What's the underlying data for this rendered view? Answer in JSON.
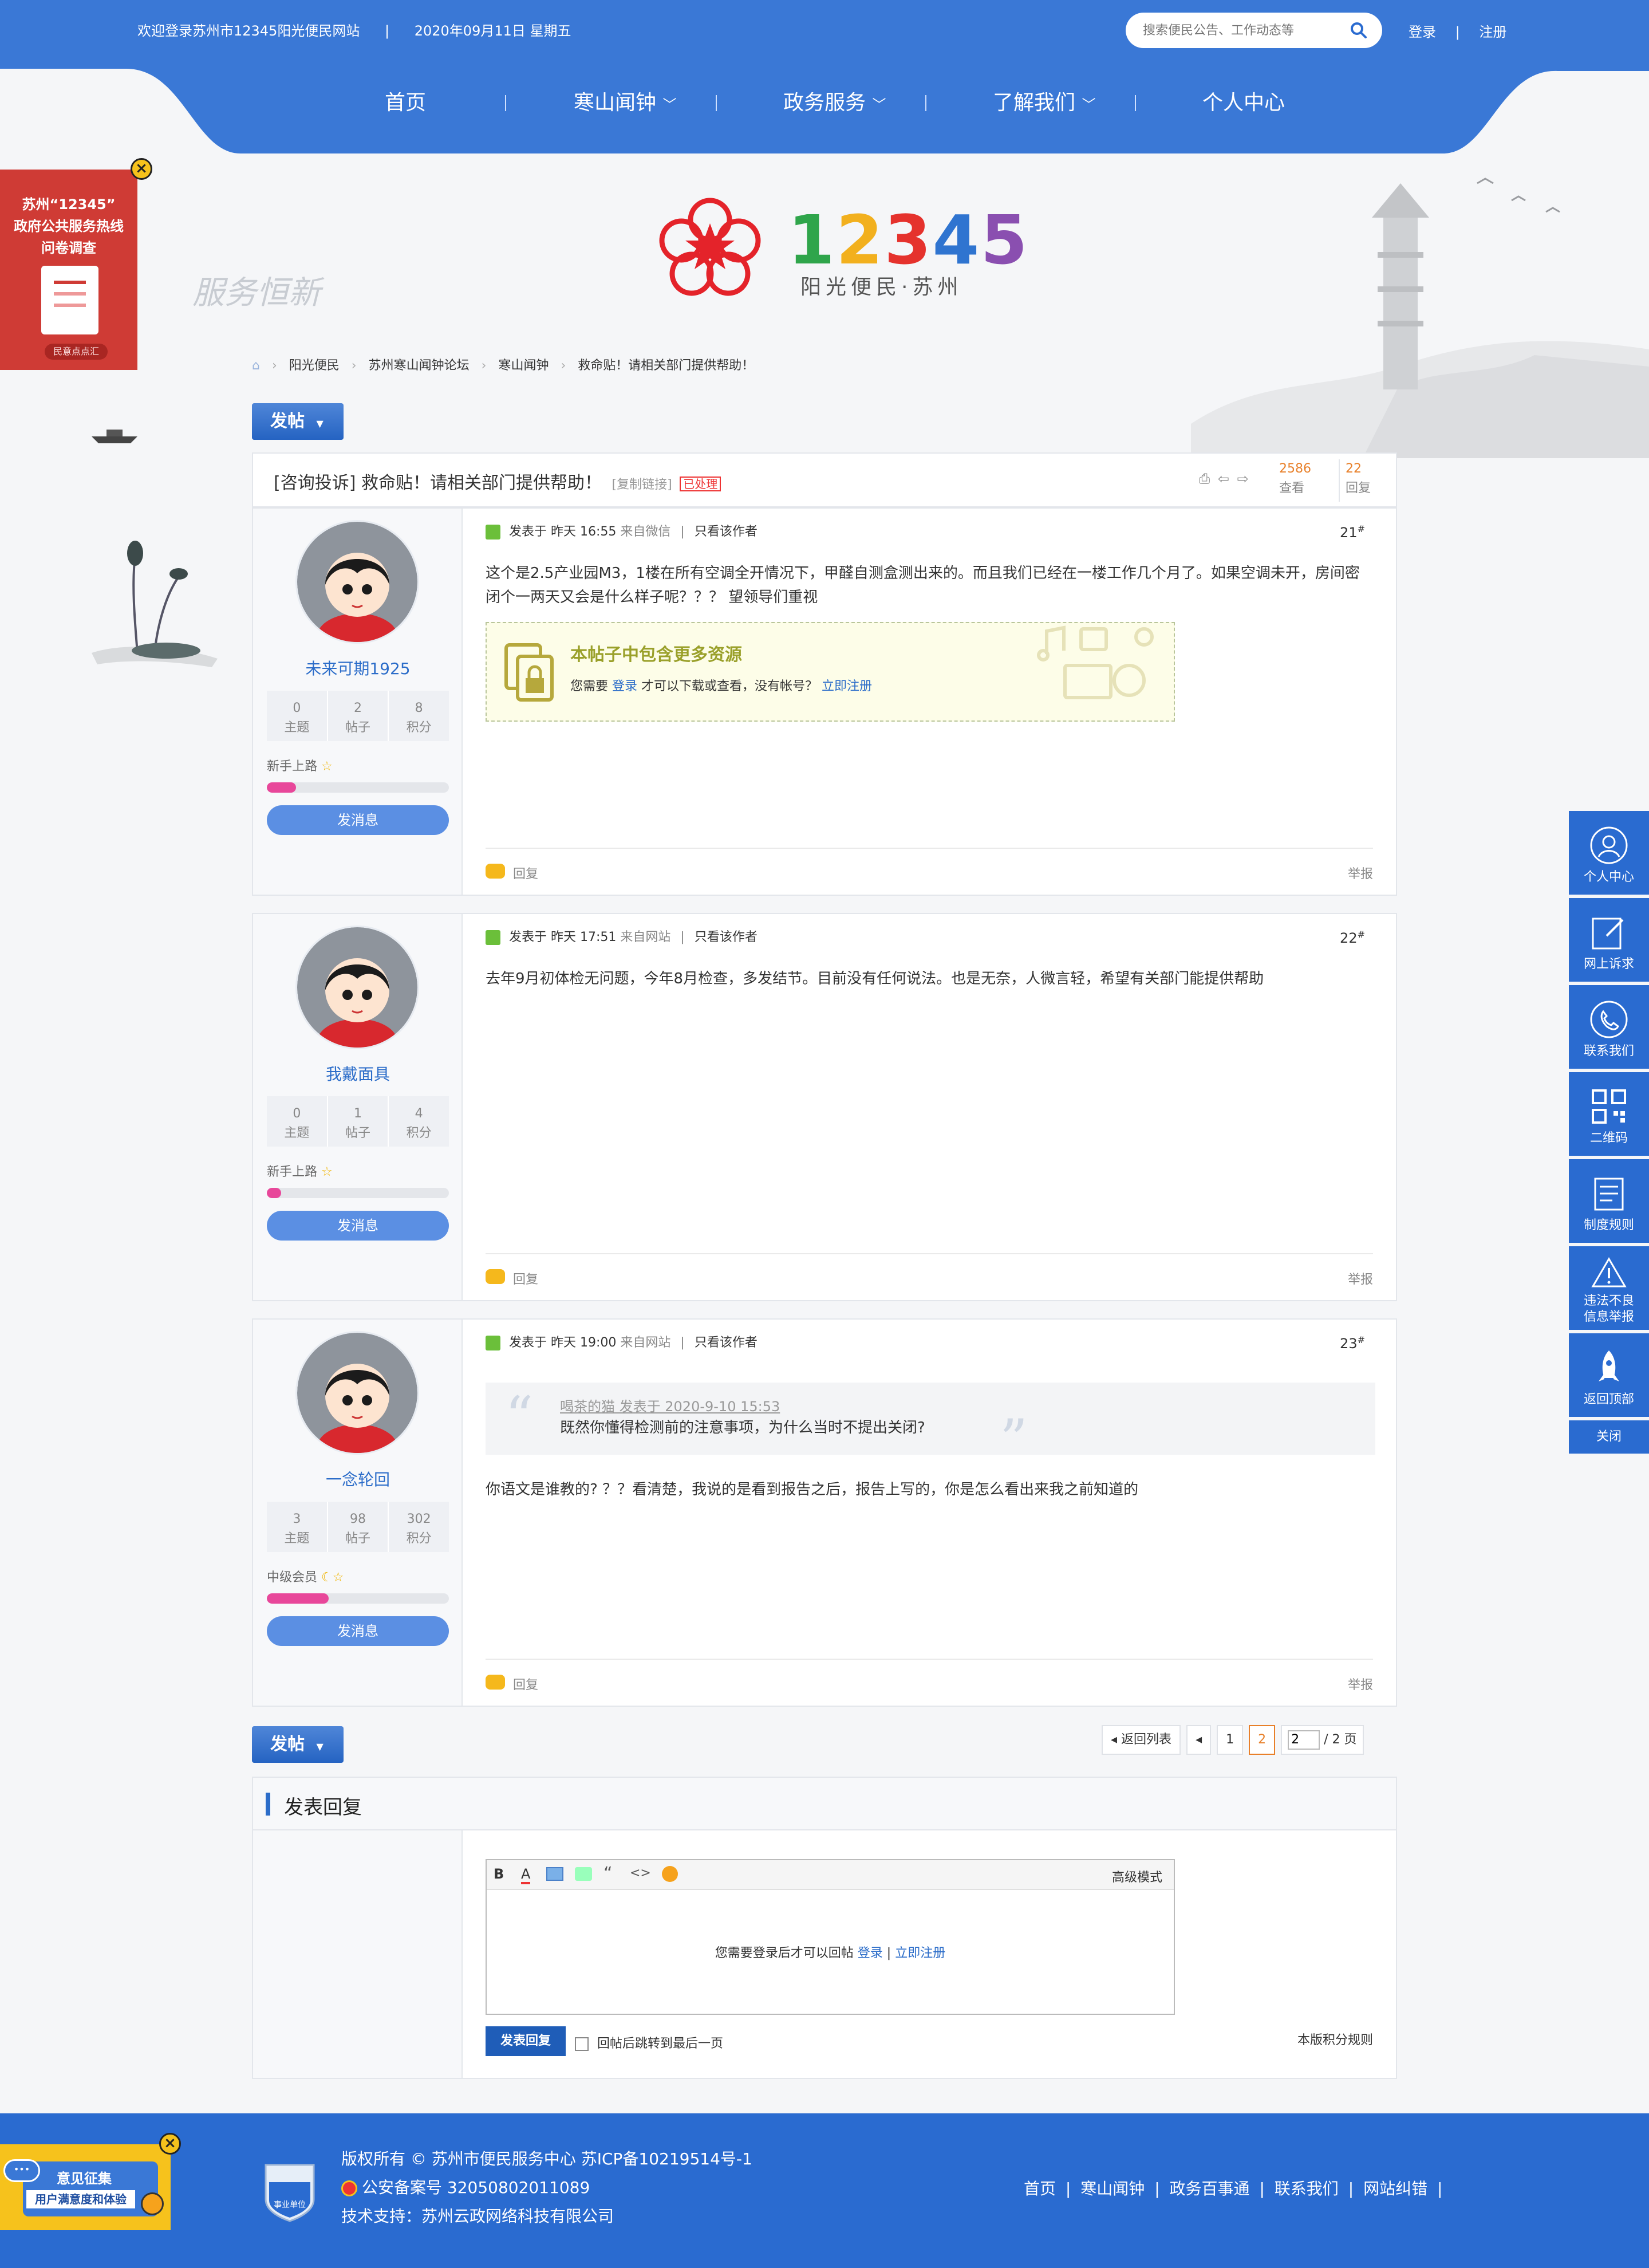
{
  "header": {
    "welcome": "欢迎登录苏州市12345阳光便民网站",
    "divider": "|",
    "date": "2020年09月11日 星期五",
    "search_placeholder": "搜索便民公告、工作动态等",
    "login": "登录",
    "register": "注册",
    "link_divider": "|"
  },
  "nav": {
    "items": [
      "首页",
      "寒山闻钟",
      "政务服务",
      "了解我们",
      "个人中心"
    ]
  },
  "logo": {
    "number": "12345",
    "subtitle": "阳光便民·苏州",
    "calligraphy": "服务恒新"
  },
  "survey_ad": {
    "line1": "苏州“12345”",
    "line2": "政府公共服务热线",
    "line3": "问卷调查",
    "button": "民意点点汇"
  },
  "breadcrumb": [
    "阳光便民",
    "苏州寒山闻钟论坛",
    "寒山闻钟",
    "救命贴！请相关部门提供帮助！"
  ],
  "post_button": "发帖",
  "thread": {
    "title": "[咨询投诉] 救命贴！请相关部门提供帮助！",
    "copy_link": "[复制链接]",
    "status": "已处理",
    "views": "2586",
    "views_label": "查看",
    "replies": "22",
    "replies_label": "回复"
  },
  "posts": [
    {
      "username": "未来可期1925",
      "stats": [
        {
          "v": "0",
          "l": "主题"
        },
        {
          "v": "2",
          "l": "帖子"
        },
        {
          "v": "8",
          "l": "积分"
        }
      ],
      "level": "新手上路",
      "progress": 0.16,
      "msg_button": "发消息",
      "meta_prefix": "发表于 昨天 16:55",
      "meta_source": "来自微信",
      "meta_only": "只看该作者",
      "floor": "21",
      "content": "这个是2.5产业园M3，1楼在所有空调全开情况下，甲醛自测盒测出来的。而且我们已经在一楼工作几个月了。如果空调未开，房间密闭个一两天又会是什么样子呢？？？ 望领导们重视",
      "reply": "回复",
      "report": "举报"
    },
    {
      "username": "我戴面具",
      "stats": [
        {
          "v": "0",
          "l": "主题"
        },
        {
          "v": "1",
          "l": "帖子"
        },
        {
          "v": "4",
          "l": "积分"
        }
      ],
      "level": "新手上路",
      "progress": 0.08,
      "msg_button": "发消息",
      "meta_prefix": "发表于 昨天 17:51",
      "meta_source": "来自网站",
      "meta_only": "只看该作者",
      "floor": "22",
      "content": "去年9月初体检无问题，今年8月检查，多发结节。目前没有任何说法。也是无奈，人微言轻，希望有关部门能提供帮助",
      "reply": "回复",
      "report": "举报"
    },
    {
      "username": "一念轮回",
      "stats": [
        {
          "v": "3",
          "l": "主题"
        },
        {
          "v": "98",
          "l": "帖子"
        },
        {
          "v": "302",
          "l": "积分"
        }
      ],
      "level": "中级会员",
      "progress": 0.34,
      "msg_button": "发消息",
      "meta_prefix": "发表于 昨天 19:00",
      "meta_source": "来自网站",
      "meta_only": "只看该作者",
      "floor": "23",
      "quote_author": "喝茶的猫 发表于 2020-9-10 15:53",
      "quote_text": "既然你懂得检测前的注意事项，为什么当时不提出关闭?",
      "content": "你语文是谁教的? ？？看清楚，我说的是看到报告之后，报告上写的，你是怎么看出来我之前知道的",
      "reply": "回复",
      "report": "举报"
    }
  ],
  "attachment": {
    "title": "本帖子中包含更多资源",
    "text1": "您需要",
    "login": "登录",
    "text2": "才可以下载或查看，没有帐号？",
    "register": "立即注册"
  },
  "pagination": {
    "back": "返回列表",
    "pages": [
      "1",
      "2"
    ],
    "current": "2",
    "input_value": "2",
    "total": "/ 2 页"
  },
  "reply_box": {
    "title": "发表回复",
    "advanced": "高级模式",
    "login_prompt": "您需要登录后才可以回帖",
    "login": "登录",
    "sep": "|",
    "register": "立即注册",
    "submit": "发表回复",
    "jump_label": "回帖后跳转到最后一页",
    "rules": "本版积分规则"
  },
  "right_panel": [
    "个人中心",
    "网上诉求",
    "联系我们",
    "二维码",
    "制度规则",
    "违法不良\n信息举报",
    "返回顶部"
  ],
  "close_label": "关闭",
  "feedback_ad": {
    "title": "意见征集",
    "subtitle": "用户满意度和体验"
  },
  "footer": {
    "copyright": "版权所有 © 苏州市便民服务中心 苏ICP备10219514号-1",
    "police": "公安备案号 32050802011089",
    "support": "技术支持：苏州云政网络科技有限公司",
    "badge": "事业单位",
    "links": [
      "首页",
      "寒山闻钟",
      "政务百事通",
      "联系我们",
      "网站纠错"
    ]
  },
  "colors": {
    "brand_blue": "#2a6bd0",
    "accent_orange": "#e8802a",
    "link_blue": "#2c6dc9"
  }
}
